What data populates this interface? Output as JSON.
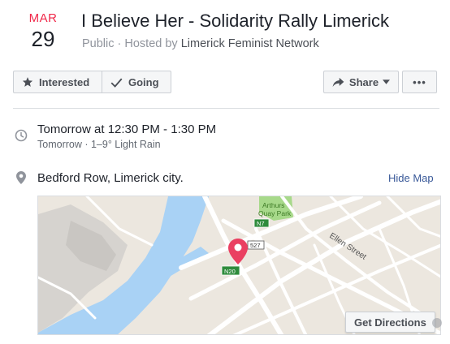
{
  "event": {
    "month": "MAR",
    "day": "29",
    "title": "I Believe Her - Solidarity Rally Limerick",
    "privacy": "Public",
    "hosted_by_prefix": "Hosted by",
    "host": "Limerick Feminist Network"
  },
  "actions": {
    "interested_label": "Interested",
    "going_label": "Going",
    "share_label": "Share",
    "more_label": "•••"
  },
  "time": {
    "main": "Tomorrow at 12:30 PM - 1:30 PM",
    "sub": "Tomorrow · 1–9° Light Rain"
  },
  "location": {
    "main": "Bedford Row, Limerick city.",
    "hide_map_label": "Hide Map"
  },
  "map": {
    "labels": {
      "park_line1": "Arthurs",
      "park_line2": "Quay Park",
      "road_n7": "N7",
      "road_r527": "527",
      "road_n20": "N20",
      "street": "Ellen Street"
    },
    "get_directions_label": "Get Directions",
    "colors": {
      "land": "#ece7df",
      "water": "#a9d2f5",
      "road": "#ffffff",
      "park": "#a7d98a",
      "pin": "#ea4061",
      "badge": "#2e8b3c"
    }
  },
  "colors": {
    "date_red": "#f02849",
    "link_blue": "#385898"
  }
}
